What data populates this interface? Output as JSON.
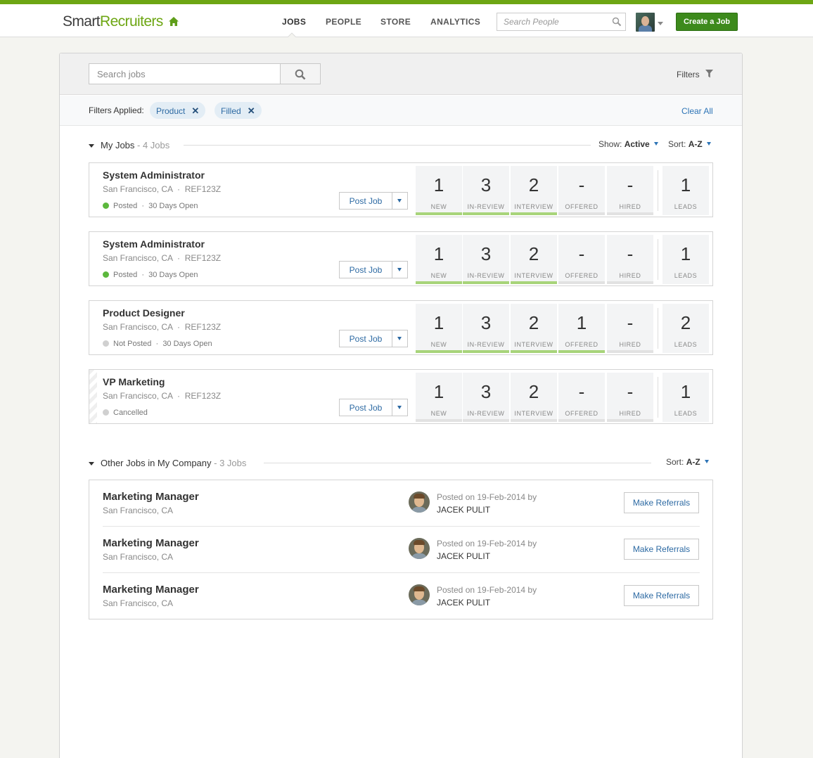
{
  "brand": {
    "logo_dark": "Smart",
    "logo_green": "Recruiters",
    "accent": "#6da613"
  },
  "nav": {
    "items": [
      {
        "label": "JOBS",
        "active": true
      },
      {
        "label": "PEOPLE",
        "active": false
      },
      {
        "label": "STORE",
        "active": false
      },
      {
        "label": "ANALYTICS",
        "active": false
      }
    ],
    "search_placeholder": "Search People",
    "create_job_label": "Create a Job"
  },
  "search": {
    "placeholder": "Search jobs",
    "filters_label": "Filters"
  },
  "filters": {
    "applied_label": "Filters Applied:",
    "chips": [
      "Product",
      "Filled"
    ],
    "clear_label": "Clear All"
  },
  "my_jobs": {
    "title": "My Jobs",
    "count": " - 4 Jobs",
    "show_label": "Show:",
    "show_value": "Active",
    "sort_label": "Sort:",
    "sort_value": "A-Z",
    "post_label": "Post Job",
    "stage_labels": [
      "NEW",
      "IN-REVIEW",
      "INTERVIEW",
      "OFFERED",
      "HIRED",
      "LEADS"
    ],
    "jobs": [
      {
        "title": "System Administrator",
        "location": "San Francisco, CA",
        "ref": "REF123Z",
        "status": "Posted",
        "open": "30 Days Open",
        "counts": [
          "1",
          "3",
          "2",
          "-",
          "-",
          "1"
        ]
      },
      {
        "title": "System Administrator",
        "location": "San Francisco, CA",
        "ref": "REF123Z",
        "status": "Posted",
        "open": "30 Days Open",
        "counts": [
          "1",
          "3",
          "2",
          "-",
          "-",
          "1"
        ]
      },
      {
        "title": "Product Designer",
        "location": "San Francisco, CA",
        "ref": "REF123Z",
        "status": "Not Posted",
        "open": "30 Days Open",
        "counts": [
          "1",
          "3",
          "2",
          "1",
          "-",
          "2"
        ]
      },
      {
        "title": "VP Marketing",
        "location": "San Francisco, CA",
        "ref": "REF123Z",
        "status": "Cancelled",
        "open": "",
        "counts": [
          "1",
          "3",
          "2",
          "-",
          "-",
          "1"
        ]
      }
    ]
  },
  "other_jobs": {
    "title": "Other Jobs in My Company",
    "count": " - 3 Jobs",
    "sort_label": "Sort:",
    "sort_value": "A-Z",
    "referral_label": "Make Referrals",
    "jobs": [
      {
        "title": "Marketing Manager",
        "location": "San Francisco, CA",
        "posted": "Posted on 19-Feb-2014 by",
        "author": "JACEK PULIT"
      },
      {
        "title": "Marketing Manager",
        "location": "San Francisco, CA",
        "posted": "Posted on 19-Feb-2014 by",
        "author": "JACEK PULIT"
      },
      {
        "title": "Marketing Manager",
        "location": "San Francisco, CA",
        "posted": "Posted on 19-Feb-2014 by",
        "author": "JACEK PULIT"
      }
    ]
  }
}
